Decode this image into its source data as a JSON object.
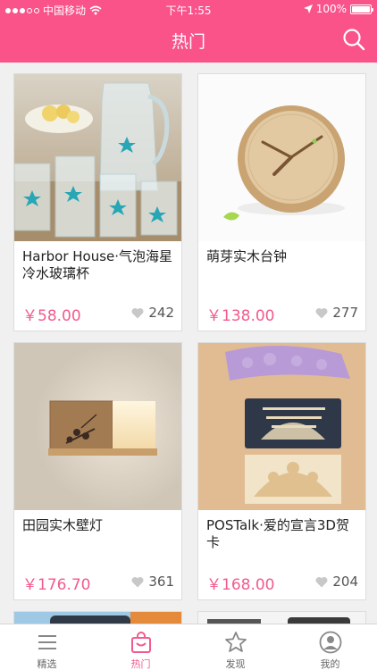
{
  "status_bar": {
    "carrier": "中国移动",
    "time": "下午1:55",
    "battery": "100%",
    "signal_bars_filled": 3,
    "signal_bars_total": 5
  },
  "nav": {
    "title": "热门",
    "search_icon": "search-icon"
  },
  "products": [
    {
      "name": "Harbor House·气泡海星冷水玻璃杯",
      "price": "￥58.00",
      "likes": "242",
      "image": "glassware-photo"
    },
    {
      "name": "萌芽实木台钟",
      "price": "￥138.00",
      "likes": "277",
      "image": "wood-clock-photo"
    },
    {
      "name": "田园实木壁灯",
      "price": "￥176.70",
      "likes": "361",
      "image": "wall-lamp-photo"
    },
    {
      "name": "POSTalk·爱的宣言3D贺卡",
      "price": "￥168.00",
      "likes": "204",
      "image": "greeting-card-photo"
    }
  ],
  "tabs": [
    {
      "label": "精选",
      "icon": "list-icon",
      "active": false
    },
    {
      "label": "热门",
      "icon": "bag-icon",
      "active": true
    },
    {
      "label": "发现",
      "icon": "star-icon",
      "active": false
    },
    {
      "label": "我的",
      "icon": "user-icon",
      "active": false
    }
  ],
  "colors": {
    "accent": "#f9538a",
    "price": "#f25b8c"
  }
}
